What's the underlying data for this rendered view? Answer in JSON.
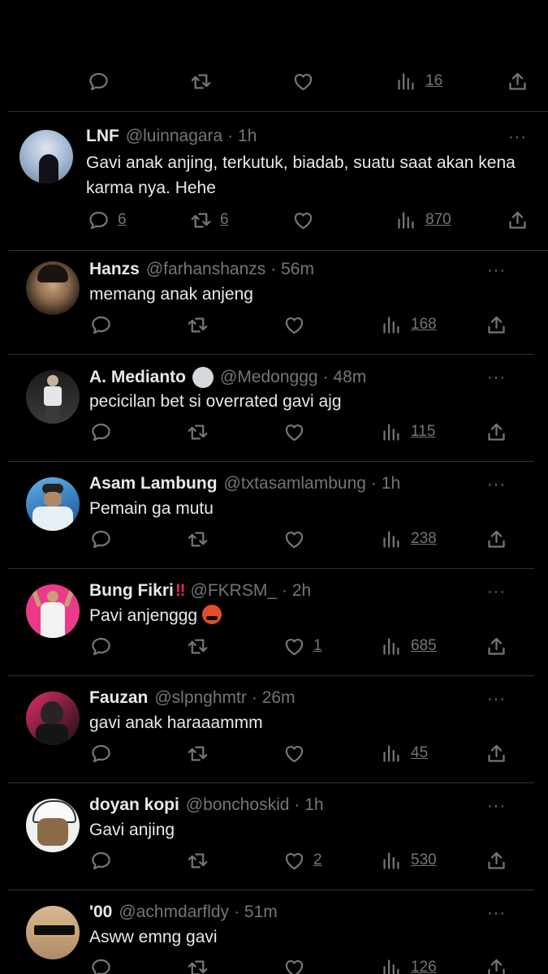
{
  "top_actions": {
    "views": "16"
  },
  "tweets": [
    {
      "name": "LNF",
      "handle": "@luinnagara",
      "time": "· 1h",
      "text": "Gavi anak anjing, terkutuk, biadab, suatu saat akan kena karma nya. Hehe",
      "replies": "6",
      "retweets": "6",
      "likes": "",
      "views": "870"
    },
    {
      "name": "Hanzs",
      "handle": "@farhanshanzs",
      "time": "· 56m",
      "text": "memang anak anjeng",
      "replies": "",
      "retweets": "",
      "likes": "",
      "views": "168"
    },
    {
      "name": "A. Medianto",
      "handle": "@Medonggg",
      "time": "· 48m",
      "text": "pecicilan bet si overrated gavi ajg",
      "replies": "",
      "retweets": "",
      "likes": "",
      "views": "115"
    },
    {
      "name": "Asam Lambung",
      "handle": "@txtasamlambung",
      "time": "· 1h",
      "text": "Pemain ga mutu",
      "replies": "",
      "retweets": "",
      "likes": "",
      "views": "238"
    },
    {
      "name": "Bung Fikri",
      "name_suffix": "‼",
      "handle": "@FKRSM_",
      "time": "· 2h",
      "text": "Pavi anjenggg",
      "replies": "",
      "retweets": "",
      "likes": "1",
      "views": "685"
    },
    {
      "name": "Fauzan",
      "handle": "@slpnghmtr",
      "time": "· 26m",
      "text": "gavi anak haraaammm",
      "replies": "",
      "retweets": "",
      "likes": "",
      "views": "45"
    },
    {
      "name": "doyan kopi",
      "handle": "@bonchoskid",
      "time": "· 1h",
      "text": "Gavi anjing",
      "replies": "",
      "retweets": "",
      "likes": "2",
      "views": "530"
    },
    {
      "name": "'00",
      "handle": "@achmdarfldy",
      "time": "· 51m",
      "text": "Asww emng gavi",
      "replies": "",
      "retweets": "",
      "likes": "",
      "views": "126"
    }
  ],
  "more_label": "···",
  "icons": [
    "reply-icon",
    "retweet-icon",
    "like-icon",
    "views-icon",
    "share-icon",
    "more-icon",
    "verified-badge-icon",
    "emoji-icon"
  ],
  "colors": {
    "background": "#000000",
    "text": "#e7e9ea",
    "muted": "#71767b",
    "divider": "#2f3336"
  }
}
